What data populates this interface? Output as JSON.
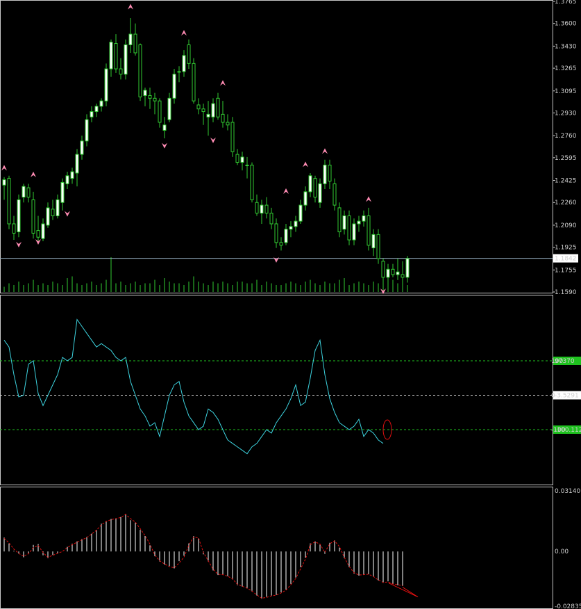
{
  "chart_data": [
    {
      "type": "candlestick",
      "ylim": [
        1.159,
        1.3765
      ],
      "yticks": [
        "1.3765",
        "1.3600",
        "1.3430",
        "1.3265",
        "1.3095",
        "1.2930",
        "1.2760",
        "1.2595",
        "1.2425",
        "1.2260",
        "1.2090",
        "1.1925",
        "1.1755",
        "1.1590"
      ],
      "current_price": 1.1842,
      "current_price_label": "1.1842",
      "candles": [
        [
          1.239,
          1.245,
          1.228,
          1.243
        ],
        [
          1.244,
          1.246,
          1.206,
          1.21
        ],
        [
          1.21,
          1.216,
          1.198,
          1.203
        ],
        [
          1.204,
          1.232,
          1.2,
          1.228
        ],
        [
          1.23,
          1.24,
          1.226,
          1.238
        ],
        [
          1.237,
          1.24,
          1.226,
          1.23
        ],
        [
          1.228,
          1.234,
          1.199,
          1.203
        ],
        [
          1.205,
          1.216,
          1.196,
          1.2
        ],
        [
          1.199,
          1.214,
          1.197,
          1.21
        ],
        [
          1.209,
          1.226,
          1.207,
          1.222
        ],
        [
          1.221,
          1.228,
          1.213,
          1.216
        ],
        [
          1.216,
          1.232,
          1.214,
          1.228
        ],
        [
          1.226,
          1.244,
          1.22,
          1.241
        ],
        [
          1.24,
          1.249,
          1.236,
          1.246
        ],
        [
          1.244,
          1.252,
          1.24,
          1.249
        ],
        [
          1.248,
          1.266,
          1.238,
          1.262
        ],
        [
          1.262,
          1.276,
          1.258,
          1.272
        ],
        [
          1.272,
          1.292,
          1.268,
          1.288
        ],
        [
          1.29,
          1.298,
          1.286,
          1.294
        ],
        [
          1.294,
          1.3,
          1.29,
          1.298
        ],
        [
          1.298,
          1.304,
          1.294,
          1.302
        ],
        [
          1.302,
          1.33,
          1.298,
          1.326
        ],
        [
          1.326,
          1.348,
          1.32,
          1.346
        ],
        [
          1.345,
          1.352,
          1.323,
          1.326
        ],
        [
          1.326,
          1.334,
          1.318,
          1.322
        ],
        [
          1.322,
          1.348,
          1.318,
          1.344
        ],
        [
          1.344,
          1.364,
          1.338,
          1.352
        ],
        [
          1.352,
          1.36,
          1.336,
          1.338
        ],
        [
          1.344,
          1.345,
          1.302,
          1.305
        ],
        [
          1.306,
          1.312,
          1.298,
          1.31
        ],
        [
          1.306,
          1.312,
          1.296,
          1.304
        ],
        [
          1.304,
          1.308,
          1.292,
          1.302
        ],
        [
          1.302,
          1.304,
          1.282,
          1.286
        ],
        [
          1.28,
          1.29,
          1.274,
          1.284
        ],
        [
          1.288,
          1.308,
          1.286,
          1.304
        ],
        [
          1.304,
          1.326,
          1.3,
          1.322
        ],
        [
          1.324,
          1.328,
          1.316,
          1.324
        ],
        [
          1.324,
          1.34,
          1.32,
          1.336
        ],
        [
          1.344,
          1.348,
          1.326,
          1.33
        ],
        [
          1.33,
          1.334,
          1.3,
          1.302
        ],
        [
          1.299,
          1.304,
          1.292,
          1.296
        ],
        [
          1.296,
          1.3,
          1.284,
          1.294
        ],
        [
          1.29,
          1.302,
          1.276,
          1.292
        ],
        [
          1.29,
          1.304,
          1.286,
          1.3
        ],
        [
          1.304,
          1.308,
          1.288,
          1.29
        ],
        [
          1.292,
          1.302,
          1.282,
          1.286
        ],
        [
          1.286,
          1.292,
          1.28,
          1.284
        ],
        [
          1.286,
          1.29,
          1.26,
          1.264
        ],
        [
          1.262,
          1.266,
          1.254,
          1.256
        ],
        [
          1.256,
          1.264,
          1.25,
          1.26
        ],
        [
          1.254,
          1.26,
          1.244,
          1.254
        ],
        [
          1.254,
          1.256,
          1.226,
          1.228
        ],
        [
          1.226,
          1.232,
          1.216,
          1.218
        ],
        [
          1.218,
          1.228,
          1.21,
          1.224
        ],
        [
          1.224,
          1.23,
          1.214,
          1.218
        ],
        [
          1.218,
          1.222,
          1.206,
          1.21
        ],
        [
          1.21,
          1.214,
          1.192,
          1.196
        ],
        [
          1.196,
          1.2,
          1.19,
          1.194
        ],
        [
          1.196,
          1.21,
          1.194,
          1.206
        ],
        [
          1.206,
          1.212,
          1.2,
          1.208
        ],
        [
          1.208,
          1.216,
          1.204,
          1.212
        ],
        [
          1.212,
          1.228,
          1.21,
          1.224
        ],
        [
          1.224,
          1.238,
          1.22,
          1.234
        ],
        [
          1.234,
          1.248,
          1.23,
          1.246
        ],
        [
          1.244,
          1.246,
          1.226,
          1.23
        ],
        [
          1.226,
          1.244,
          1.222,
          1.24
        ],
        [
          1.24,
          1.258,
          1.236,
          1.254
        ],
        [
          1.254,
          1.258,
          1.236,
          1.242
        ],
        [
          1.24,
          1.244,
          1.22,
          1.224
        ],
        [
          1.222,
          1.226,
          1.2,
          1.204
        ],
        [
          1.206,
          1.22,
          1.202,
          1.216
        ],
        [
          1.216,
          1.22,
          1.194,
          1.198
        ],
        [
          1.198,
          1.214,
          1.194,
          1.21
        ],
        [
          1.21,
          1.216,
          1.204,
          1.212
        ],
        [
          1.212,
          1.22,
          1.208,
          1.216
        ],
        [
          1.216,
          1.222,
          1.19,
          1.194
        ],
        [
          1.192,
          1.206,
          1.186,
          1.202
        ],
        [
          1.202,
          1.206,
          1.18,
          1.184
        ],
        [
          1.182,
          1.184,
          1.164,
          1.17
        ],
        [
          1.17,
          1.18,
          1.164,
          1.176
        ],
        [
          1.176,
          1.18,
          1.17,
          1.172
        ],
        [
          1.172,
          1.184,
          1.168,
          1.174
        ],
        [
          1.172,
          1.182,
          1.166,
          1.17
        ],
        [
          1.17,
          1.186,
          1.166,
          1.184
        ]
      ],
      "volume": [
        3,
        5,
        4,
        6,
        4,
        5,
        7,
        4,
        5,
        4,
        6,
        5,
        4,
        8,
        9,
        5,
        4,
        5,
        6,
        4,
        5,
        7,
        20,
        5,
        6,
        4,
        5,
        6,
        4,
        5,
        5,
        7,
        4,
        8,
        6,
        5,
        5,
        4,
        6,
        9,
        6,
        5,
        4,
        6,
        5,
        6,
        5,
        4,
        6,
        6,
        5,
        5,
        7,
        4,
        6,
        5,
        4,
        4,
        5,
        6,
        5,
        4,
        6,
        7,
        5,
        4,
        6,
        5,
        5,
        7,
        8,
        4,
        5,
        6,
        5,
        4,
        6,
        5,
        5,
        6,
        7,
        5,
        6,
        4
      ],
      "fractal_up_markers": [
        {
          "index": 0,
          "price": 1.2515
        },
        {
          "index": 6,
          "price": 1.2465
        },
        {
          "index": 26,
          "price": 1.372
        },
        {
          "index": 37,
          "price": 1.3525
        },
        {
          "index": 45,
          "price": 1.315
        },
        {
          "index": 58,
          "price": 1.234
        },
        {
          "index": 62,
          "price": 1.254
        },
        {
          "index": 66,
          "price": 1.264
        },
        {
          "index": 75,
          "price": 1.228
        }
      ],
      "fractal_down_markers": [
        {
          "index": 3,
          "price": 1.195
        },
        {
          "index": 7,
          "price": 1.197
        },
        {
          "index": 13,
          "price": 1.218
        },
        {
          "index": 33,
          "price": 1.269
        },
        {
          "index": 43,
          "price": 1.273
        },
        {
          "index": 56,
          "price": 1.1835
        },
        {
          "index": 78,
          "price": 1.16
        }
      ]
    },
    {
      "type": "line",
      "name_label": "",
      "ylim": [
        -100,
        100
      ],
      "levels": [
        {
          "value": 100,
          "label": "100",
          "tag": "97370",
          "tag_color": "#1fc21f"
        },
        {
          "value": 0,
          "label": "0",
          "tag": "-3.5291",
          "tag_color": "#ffffff"
        },
        {
          "value": -100,
          "label": "-100",
          "tag": "-100.1120",
          "tag_color": "#1fc21f"
        }
      ],
      "values": [
        160,
        140,
        60,
        -5,
        0,
        90,
        100,
        5,
        -30,
        0,
        30,
        60,
        110,
        100,
        110,
        220,
        200,
        180,
        160,
        140,
        150,
        140,
        130,
        110,
        100,
        110,
        40,
        0,
        -40,
        -60,
        -90,
        -80,
        -120,
        -60,
        0,
        30,
        40,
        -20,
        -60,
        -80,
        -100,
        -90,
        -40,
        -50,
        -70,
        -100,
        -130,
        -140,
        -150,
        -160,
        -170,
        -150,
        -140,
        -120,
        -100,
        -110,
        -80,
        -60,
        -40,
        -10,
        30,
        -30,
        -20,
        50,
        130,
        160,
        60,
        -10,
        -50,
        -80,
        -90,
        -100,
        -90,
        -70,
        -120,
        -100,
        -110,
        -130,
        -140
      ]
    },
    {
      "type": "histogram",
      "ylim": [
        -0.02835,
        0.0314
      ],
      "yticks": [
        "0.03140",
        "0.00",
        "-0.02835"
      ],
      "values": [
        0.0072,
        0.0042,
        0.0003,
        -0.0012,
        -0.003,
        -0.0008,
        0.0034,
        0.0038,
        -0.002,
        -0.0035,
        -0.0018,
        -0.0008,
        0.0,
        0.0024,
        0.004,
        0.0052,
        0.0065,
        0.0075,
        0.0092,
        0.0112,
        0.0144,
        0.0158,
        0.0168,
        0.0172,
        0.0178,
        0.0195,
        0.0162,
        0.015,
        0.0112,
        0.008,
        0.0032,
        -0.0025,
        -0.0052,
        -0.0068,
        -0.0075,
        -0.0088,
        -0.005,
        -0.0022,
        0.0042,
        0.008,
        0.0068,
        -0.0015,
        -0.0052,
        -0.0098,
        -0.0122,
        -0.0118,
        -0.0128,
        -0.0145,
        -0.0175,
        -0.0182,
        -0.0192,
        -0.0208,
        -0.0228,
        -0.0245,
        -0.0235,
        -0.0228,
        -0.0225,
        -0.0212,
        -0.0198,
        -0.0168,
        -0.0135,
        -0.0082,
        -0.0032,
        0.0042,
        0.0052,
        0.0035,
        -0.0012,
        0.0045,
        0.0058,
        0.002,
        -0.0035,
        -0.0082,
        -0.0115,
        -0.0125,
        -0.012,
        -0.0118,
        -0.0132,
        -0.015,
        -0.0162,
        -0.0155,
        -0.0168,
        -0.0175,
        -0.0178
      ],
      "signal": [
        0.0068,
        0.0045,
        0.0012,
        -0.001,
        -0.0025,
        -0.0012,
        0.002,
        0.003,
        -0.0005,
        -0.003,
        -0.002,
        -0.001,
        0.0,
        0.002,
        0.0035,
        0.0048,
        0.006,
        0.0072,
        0.009,
        0.011,
        0.0138,
        0.0155,
        0.0165,
        0.017,
        0.0176,
        0.0192,
        0.017,
        0.0152,
        0.0118,
        0.0082,
        0.0038,
        -0.0018,
        -0.0048,
        -0.0065,
        -0.0078,
        -0.0085,
        -0.006,
        -0.003,
        0.0032,
        0.0075,
        0.007,
        -0.0005,
        -0.0048,
        -0.0092,
        -0.0118,
        -0.012,
        -0.0128,
        -0.0142,
        -0.017,
        -0.018,
        -0.019,
        -0.0205,
        -0.0225,
        -0.0242,
        -0.0238,
        -0.023,
        -0.0226,
        -0.0215,
        -0.02,
        -0.0172,
        -0.014,
        -0.009,
        -0.004,
        0.0035,
        0.005,
        0.0038,
        -0.0005,
        0.004,
        0.0055,
        0.0025,
        -0.003,
        -0.0078,
        -0.011,
        -0.0122,
        -0.012,
        -0.0118,
        -0.013,
        -0.0148,
        -0.016,
        -0.0158,
        -0.0168,
        -0.0172,
        -0.0178
      ]
    }
  ],
  "colors": {
    "background": "#000000",
    "bull_body": "#ffffff",
    "bear_body": "#000000",
    "candle_outline": "#32cd32",
    "volume": "#32cd32",
    "current_price_line": "#8fa7b8",
    "fractal_marker": "#ff8cb4",
    "indicator_line": "#3dd4e0",
    "level_line": "#1fc21f",
    "histogram_bar": "#ffffff",
    "signal_line": "#e01010",
    "divergence": "#e01010",
    "axis_text": "#d0d0d0",
    "separator": "#c8c8c8"
  }
}
